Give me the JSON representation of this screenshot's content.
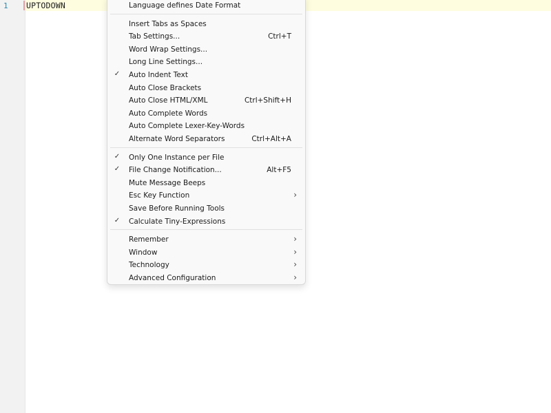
{
  "editor": {
    "line_number": "1",
    "code_line": "UPTODOWN"
  },
  "menu": {
    "groups": [
      [
        {
          "label": "Language defines Date Format",
          "shortcut": "",
          "checked": false,
          "submenu": false
        }
      ],
      [
        {
          "label": "Insert Tabs as Spaces",
          "shortcut": "",
          "checked": false,
          "submenu": false
        },
        {
          "label": "Tab Settings...",
          "shortcut": "Ctrl+T",
          "checked": false,
          "submenu": false
        },
        {
          "label": "Word Wrap Settings...",
          "shortcut": "",
          "checked": false,
          "submenu": false
        },
        {
          "label": "Long Line Settings...",
          "shortcut": "",
          "checked": false,
          "submenu": false
        },
        {
          "label": "Auto Indent Text",
          "shortcut": "",
          "checked": true,
          "submenu": false
        },
        {
          "label": "Auto Close Brackets",
          "shortcut": "",
          "checked": false,
          "submenu": false
        },
        {
          "label": "Auto Close HTML/XML",
          "shortcut": "Ctrl+Shift+H",
          "checked": false,
          "submenu": false
        },
        {
          "label": "Auto Complete Words",
          "shortcut": "",
          "checked": false,
          "submenu": false
        },
        {
          "label": "Auto Complete Lexer-Key-Words",
          "shortcut": "",
          "checked": false,
          "submenu": false
        },
        {
          "label": "Alternate Word Separators",
          "shortcut": "Ctrl+Alt+A",
          "checked": false,
          "submenu": false
        }
      ],
      [
        {
          "label": "Only One Instance per File",
          "shortcut": "",
          "checked": true,
          "submenu": false
        },
        {
          "label": "File Change Notification...",
          "shortcut": "Alt+F5",
          "checked": true,
          "submenu": false
        },
        {
          "label": "Mute Message Beeps",
          "shortcut": "",
          "checked": false,
          "submenu": false
        },
        {
          "label": "Esc Key Function",
          "shortcut": "",
          "checked": false,
          "submenu": true
        },
        {
          "label": "Save Before Running Tools",
          "shortcut": "",
          "checked": false,
          "submenu": false
        },
        {
          "label": "Calculate Tiny-Expressions",
          "shortcut": "",
          "checked": true,
          "submenu": false
        }
      ],
      [
        {
          "label": "Remember",
          "shortcut": "",
          "checked": false,
          "submenu": true
        },
        {
          "label": "Window",
          "shortcut": "",
          "checked": false,
          "submenu": true
        },
        {
          "label": "Technology",
          "shortcut": "",
          "checked": false,
          "submenu": true
        },
        {
          "label": "Advanced Configuration",
          "shortcut": "",
          "checked": false,
          "submenu": true
        }
      ]
    ],
    "check_glyph": "✓",
    "arrow_glyph": "›"
  }
}
